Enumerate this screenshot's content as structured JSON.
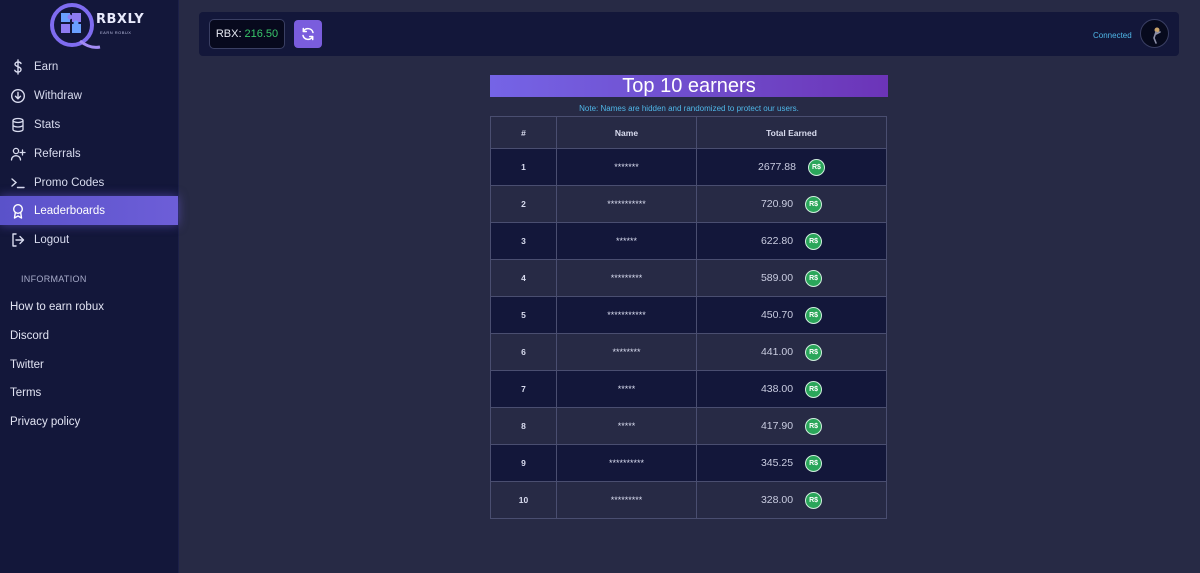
{
  "brand": {
    "name": "RBXLY",
    "tagline": "EARN ROBUX"
  },
  "sidebar": {
    "items": [
      {
        "label": "Earn",
        "icon": "dollar-icon",
        "active": false
      },
      {
        "label": "Withdraw",
        "icon": "arrow-down-circle-icon",
        "active": false
      },
      {
        "label": "Stats",
        "icon": "database-icon",
        "active": false
      },
      {
        "label": "Referrals",
        "icon": "user-plus-icon",
        "active": false
      },
      {
        "label": "Promo Codes",
        "icon": "terminal-icon",
        "active": false
      },
      {
        "label": "Leaderboards",
        "icon": "award-icon",
        "active": true
      },
      {
        "label": "Logout",
        "icon": "logout-icon",
        "active": false
      }
    ],
    "section_heading": "INFORMATION",
    "info_links": [
      "How to earn robux",
      "Discord",
      "Twitter",
      "Terms",
      "Privacy policy"
    ]
  },
  "header": {
    "balance_label": "RBX:",
    "balance_value": "216.50",
    "status": "Connected"
  },
  "leaderboard": {
    "title": "Top 10 earners",
    "note": "Note: Names are hidden and randomized to protect our users.",
    "columns": [
      "#",
      "Name",
      "Total Earned"
    ],
    "currency_badge": "R$",
    "rows": [
      {
        "rank": "1",
        "name": "*******",
        "earned": "2677.88"
      },
      {
        "rank": "2",
        "name": "***********",
        "earned": "720.90"
      },
      {
        "rank": "3",
        "name": "******",
        "earned": "622.80"
      },
      {
        "rank": "4",
        "name": "*********",
        "earned": "589.00"
      },
      {
        "rank": "5",
        "name": "***********",
        "earned": "450.70"
      },
      {
        "rank": "6",
        "name": "********",
        "earned": "441.00"
      },
      {
        "rank": "7",
        "name": "*****",
        "earned": "438.00"
      },
      {
        "rank": "8",
        "name": "*****",
        "earned": "417.90"
      },
      {
        "rank": "9",
        "name": "**********",
        "earned": "345.25"
      },
      {
        "rank": "10",
        "name": "*********",
        "earned": "328.00"
      }
    ]
  },
  "colors": {
    "accent": "#6d5ed8",
    "positive": "#38c56a",
    "link": "#4fb7e8",
    "sidebar_bg": "#13173a",
    "page_bg": "#272a45"
  }
}
